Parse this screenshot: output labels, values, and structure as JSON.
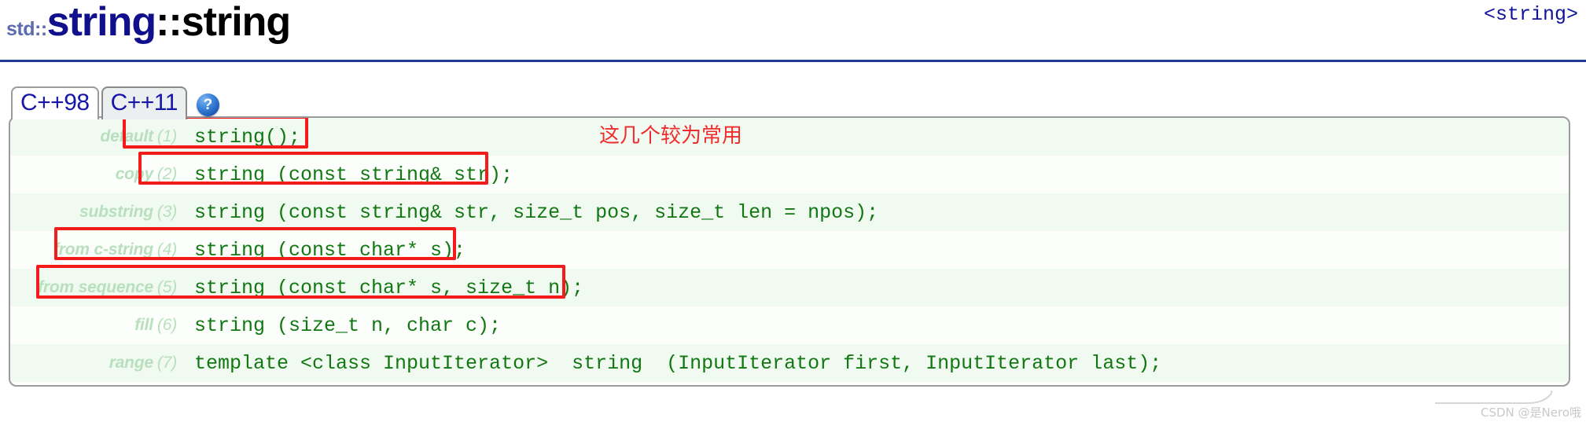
{
  "page": {
    "title_namespace": "std::",
    "title_class": "string",
    "title_separator": "::",
    "title_function": "string",
    "header_file": "<string>",
    "watermark": "CSDN @是Nero哦",
    "rule_color": "#1f3a93"
  },
  "tabs": [
    {
      "label": "C++98",
      "active": true
    },
    {
      "label": "C++11",
      "active": false
    }
  ],
  "help_icon": {
    "name": "help-icon",
    "glyph": "?"
  },
  "annotation": {
    "note_text": "这几个较为常用",
    "note_color": "#ef2b2b",
    "box_color": "#f41b1b",
    "boxed_rows": [
      1,
      2,
      4,
      5
    ]
  },
  "signatures": [
    {
      "label": "default",
      "number": "(1)",
      "code": "string();",
      "boxed": true
    },
    {
      "label": "copy",
      "number": "(2)",
      "code": "string (const string& str);",
      "boxed": true
    },
    {
      "label": "substring",
      "number": "(3)",
      "code": "string (const string& str, size_t pos, size_t len = npos);",
      "boxed": false
    },
    {
      "label": "from c-string",
      "number": "(4)",
      "code": "string (const char* s);",
      "boxed": true
    },
    {
      "label": "from sequence",
      "number": "(5)",
      "code": "string (const char* s, size_t n);",
      "boxed": true
    },
    {
      "label": "fill",
      "number": "(6)",
      "code": "string (size_t n, char c);",
      "boxed": false
    },
    {
      "label": "range",
      "number": "(7)",
      "code": "template <class InputIterator>  string  (InputIterator first, InputIterator last);",
      "boxed": false
    }
  ]
}
